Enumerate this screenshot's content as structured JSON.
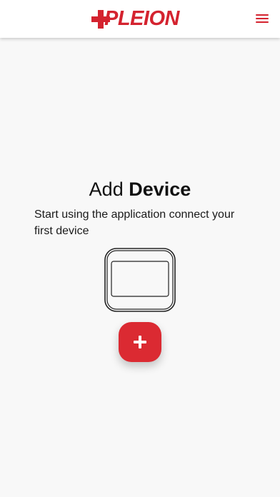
{
  "header": {
    "logo_text": "PLEION",
    "brand_color": "#d4232f",
    "menu_icon": "hamburger-menu-icon"
  },
  "main": {
    "title_prefix": "Add",
    "title_bold": "Device",
    "subtitle": "Start using the application connect your first device",
    "device_icon": "device-outline-icon",
    "add_button": {
      "icon": "plus-icon",
      "color": "#db2a32"
    }
  }
}
